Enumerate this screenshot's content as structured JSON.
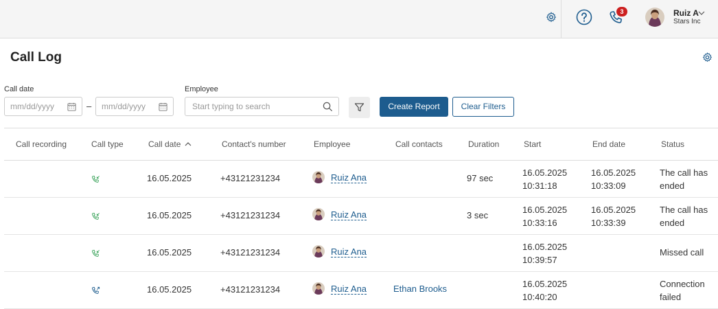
{
  "topbar": {
    "user_name": "Ruiz A",
    "company": "Stars Inc",
    "calls_badge": "3",
    "icons": [
      "settings-icon",
      "help-icon",
      "phone-icon",
      "chevron-down-icon"
    ]
  },
  "page": {
    "title": "Call Log"
  },
  "filters": {
    "call_date_label": "Call date",
    "date_from_placeholder": "mm/dd/yyyy",
    "date_to_placeholder": "mm/dd/yyyy",
    "dash": "–",
    "employee_label": "Employee",
    "employee_placeholder": "Start typing to search",
    "create_report": "Create Report",
    "clear_filters": "Clear Filters"
  },
  "table": {
    "columns": [
      "Call recording",
      "Call type",
      "Call date",
      "Contact's number",
      "Employee",
      "Call contacts",
      "Duration",
      "Start",
      "End date",
      "Status"
    ],
    "sorted_column": "Call date",
    "rows": [
      {
        "call_type": "incoming",
        "date": "16.05.2025",
        "number": "+43121231234",
        "employee": "Ruiz Ana",
        "contacts": "",
        "duration": "97 sec",
        "start_date": "16.05.2025",
        "start_time": "10:31:18",
        "end_date": "16.05.2025",
        "end_time": "10:33:09",
        "status_1": "The call has",
        "status_2": "ended"
      },
      {
        "call_type": "incoming",
        "date": "16.05.2025",
        "number": "+43121231234",
        "employee": "Ruiz Ana",
        "contacts": "",
        "duration": "3 sec",
        "start_date": "16.05.2025",
        "start_time": "10:33:16",
        "end_date": "16.05.2025",
        "end_time": "10:33:39",
        "status_1": "The call has",
        "status_2": "ended"
      },
      {
        "call_type": "incoming",
        "date": "16.05.2025",
        "number": "+43121231234",
        "employee": "Ruiz Ana",
        "contacts": "",
        "duration": "",
        "start_date": "16.05.2025",
        "start_time": "10:39:57",
        "end_date": "",
        "end_time": "",
        "status_1": "Missed call",
        "status_2": ""
      },
      {
        "call_type": "outgoing",
        "date": "16.05.2025",
        "number": "+43121231234",
        "employee": "Ruiz Ana",
        "contacts": "Ethan Brooks",
        "duration": "",
        "start_date": "16.05.2025",
        "start_time": "10:40:20",
        "end_date": "",
        "end_time": "",
        "status_1": "Connection",
        "status_2": "failed"
      }
    ]
  },
  "colors": {
    "accent": "#1d5c8e",
    "badge": "#cc1f1f",
    "incoming_icon": "#3aa35a",
    "outgoing_icon": "#1d5c8e"
  }
}
